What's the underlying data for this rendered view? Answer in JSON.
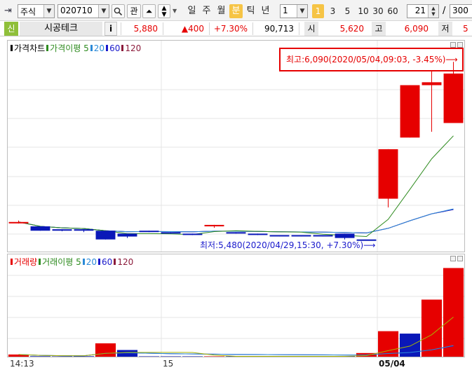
{
  "toolbar": {
    "market_type": "주식",
    "stock_code": "020710",
    "search_icon": "magnifier-icon",
    "interest_label": "관",
    "periods": [
      {
        "label": "일",
        "active": false
      },
      {
        "label": "주",
        "active": false
      },
      {
        "label": "월",
        "active": false
      },
      {
        "label": "분",
        "active": true
      },
      {
        "label": "틱",
        "active": false
      },
      {
        "label": "년",
        "active": false
      }
    ],
    "period_interval": "1",
    "minute_buttons": [
      {
        "label": "1",
        "active": true
      },
      {
        "label": "3",
        "active": false
      },
      {
        "label": "5",
        "active": false
      },
      {
        "label": "10",
        "active": false
      },
      {
        "label": "30",
        "active": false
      },
      {
        "label": "60",
        "active": false
      }
    ],
    "view_count": "21",
    "total_separator": "/",
    "total_count": "300"
  },
  "quote": {
    "badge": "신",
    "stock_name": "시공테크",
    "info_button": "i",
    "current_price": "5,880",
    "change": "▲400",
    "change_rate": "+7.30%",
    "volume": "90,713",
    "open_label": "시",
    "open_price": "5,620",
    "high_label": "고",
    "high_price": "6,090",
    "low_label": "저",
    "low_price": "5"
  },
  "price_panel": {
    "legend": [
      {
        "label": "가격차트",
        "color": "#000000"
      },
      {
        "label": "가격이평 5",
        "color": "#2e8b1f"
      },
      {
        "label": "20",
        "color": "#2b8ad8"
      },
      {
        "label": "60",
        "color": "#1a1acc"
      },
      {
        "label": "120",
        "color": "#8b1a3a"
      }
    ],
    "high_annotation": "최고:6,090(2020/05/04,09:03, -3.45%)⟶",
    "low_annotation": "최저:5,480(2020/04/29,15:30, +7.30%)⟶"
  },
  "volume_panel": {
    "legend": [
      {
        "label": "거래량",
        "color": "#e60000"
      },
      {
        "label": "거래이평 5",
        "color": "#2e8b1f"
      },
      {
        "label": "20",
        "color": "#2b8ad8"
      },
      {
        "label": "60",
        "color": "#1a1acc"
      },
      {
        "label": "120",
        "color": "#8b1a3a"
      }
    ]
  },
  "xaxis": {
    "labels": [
      "14:13",
      "15",
      "05/04"
    ]
  },
  "chart_data": {
    "type": "candlestick",
    "candles": [
      {
        "open": 5540,
        "high": 5545,
        "low": 5535,
        "close": 5540,
        "color": "red"
      },
      {
        "open": 5525,
        "high": 5525,
        "low": 5510,
        "close": 5510,
        "color": "blue"
      },
      {
        "open": 5515,
        "high": 5515,
        "low": 5508,
        "close": 5510,
        "color": "blue"
      },
      {
        "open": 5515,
        "high": 5515,
        "low": 5505,
        "close": 5510,
        "color": "blue"
      },
      {
        "open": 5510,
        "high": 5510,
        "low": 5480,
        "close": 5480,
        "color": "blue"
      },
      {
        "open": 5500,
        "high": 5500,
        "low": 5485,
        "close": 5490,
        "color": "blue"
      },
      {
        "open": 5510,
        "high": 5510,
        "low": 5505,
        "close": 5510,
        "color": "blue"
      },
      {
        "open": 5505,
        "high": 5505,
        "low": 5500,
        "close": 5505,
        "color": "blue"
      },
      {
        "open": 5500,
        "high": 5500,
        "low": 5495,
        "close": 5500,
        "color": "blue"
      },
      {
        "open": 5525,
        "high": 5530,
        "low": 5520,
        "close": 5530,
        "color": "red"
      },
      {
        "open": 5505,
        "high": 5505,
        "low": 5500,
        "close": 5505,
        "color": "blue"
      },
      {
        "open": 5500,
        "high": 5500,
        "low": 5495,
        "close": 5500,
        "color": "blue"
      },
      {
        "open": 5495,
        "high": 5495,
        "low": 5490,
        "close": 5495,
        "color": "blue"
      },
      {
        "open": 5495,
        "high": 5495,
        "low": 5490,
        "close": 5495,
        "color": "blue"
      },
      {
        "open": 5495,
        "high": 5495,
        "low": 5490,
        "close": 5495,
        "color": "blue"
      },
      {
        "open": 5500,
        "high": 5500,
        "low": 5480,
        "close": 5485,
        "color": "blue"
      },
      {
        "open": 5480,
        "high": 5480,
        "low": 5480,
        "close": 5480,
        "color": "blue"
      },
      {
        "open": 5620,
        "high": 5790,
        "low": 5590,
        "close": 5790,
        "color": "red"
      },
      {
        "open": 5830,
        "high": 6010,
        "low": 5830,
        "close": 6010,
        "color": "red"
      },
      {
        "open": 6010,
        "high": 6060,
        "low": 5850,
        "close": 6020,
        "color": "red"
      },
      {
        "open": 6050,
        "high": 6090,
        "low": 5980,
        "close": 5880,
        "color": "red"
      }
    ],
    "volume": [
      {
        "value": 1800,
        "color": "red"
      },
      {
        "value": 400,
        "color": "blue"
      },
      {
        "value": 300,
        "color": "blue"
      },
      {
        "value": 400,
        "color": "blue"
      },
      {
        "value": 11000,
        "color": "red"
      },
      {
        "value": 5500,
        "color": "blue"
      },
      {
        "value": 300,
        "color": "blue"
      },
      {
        "value": 300,
        "color": "blue"
      },
      {
        "value": 300,
        "color": "blue"
      },
      {
        "value": 300,
        "color": "red"
      },
      {
        "value": 300,
        "color": "blue"
      },
      {
        "value": 300,
        "color": "blue"
      },
      {
        "value": 300,
        "color": "blue"
      },
      {
        "value": 300,
        "color": "blue"
      },
      {
        "value": 300,
        "color": "blue"
      },
      {
        "value": 300,
        "color": "blue"
      },
      {
        "value": 3000,
        "color": "red"
      },
      {
        "value": 21000,
        "color": "red"
      },
      {
        "value": 19000,
        "color": "blue"
      },
      {
        "value": 47000,
        "color": "red"
      },
      {
        "value": 73000,
        "color": "red"
      }
    ],
    "price_ylim": [
      5460,
      6110
    ],
    "volume_ylim": [
      0,
      75000
    ]
  }
}
